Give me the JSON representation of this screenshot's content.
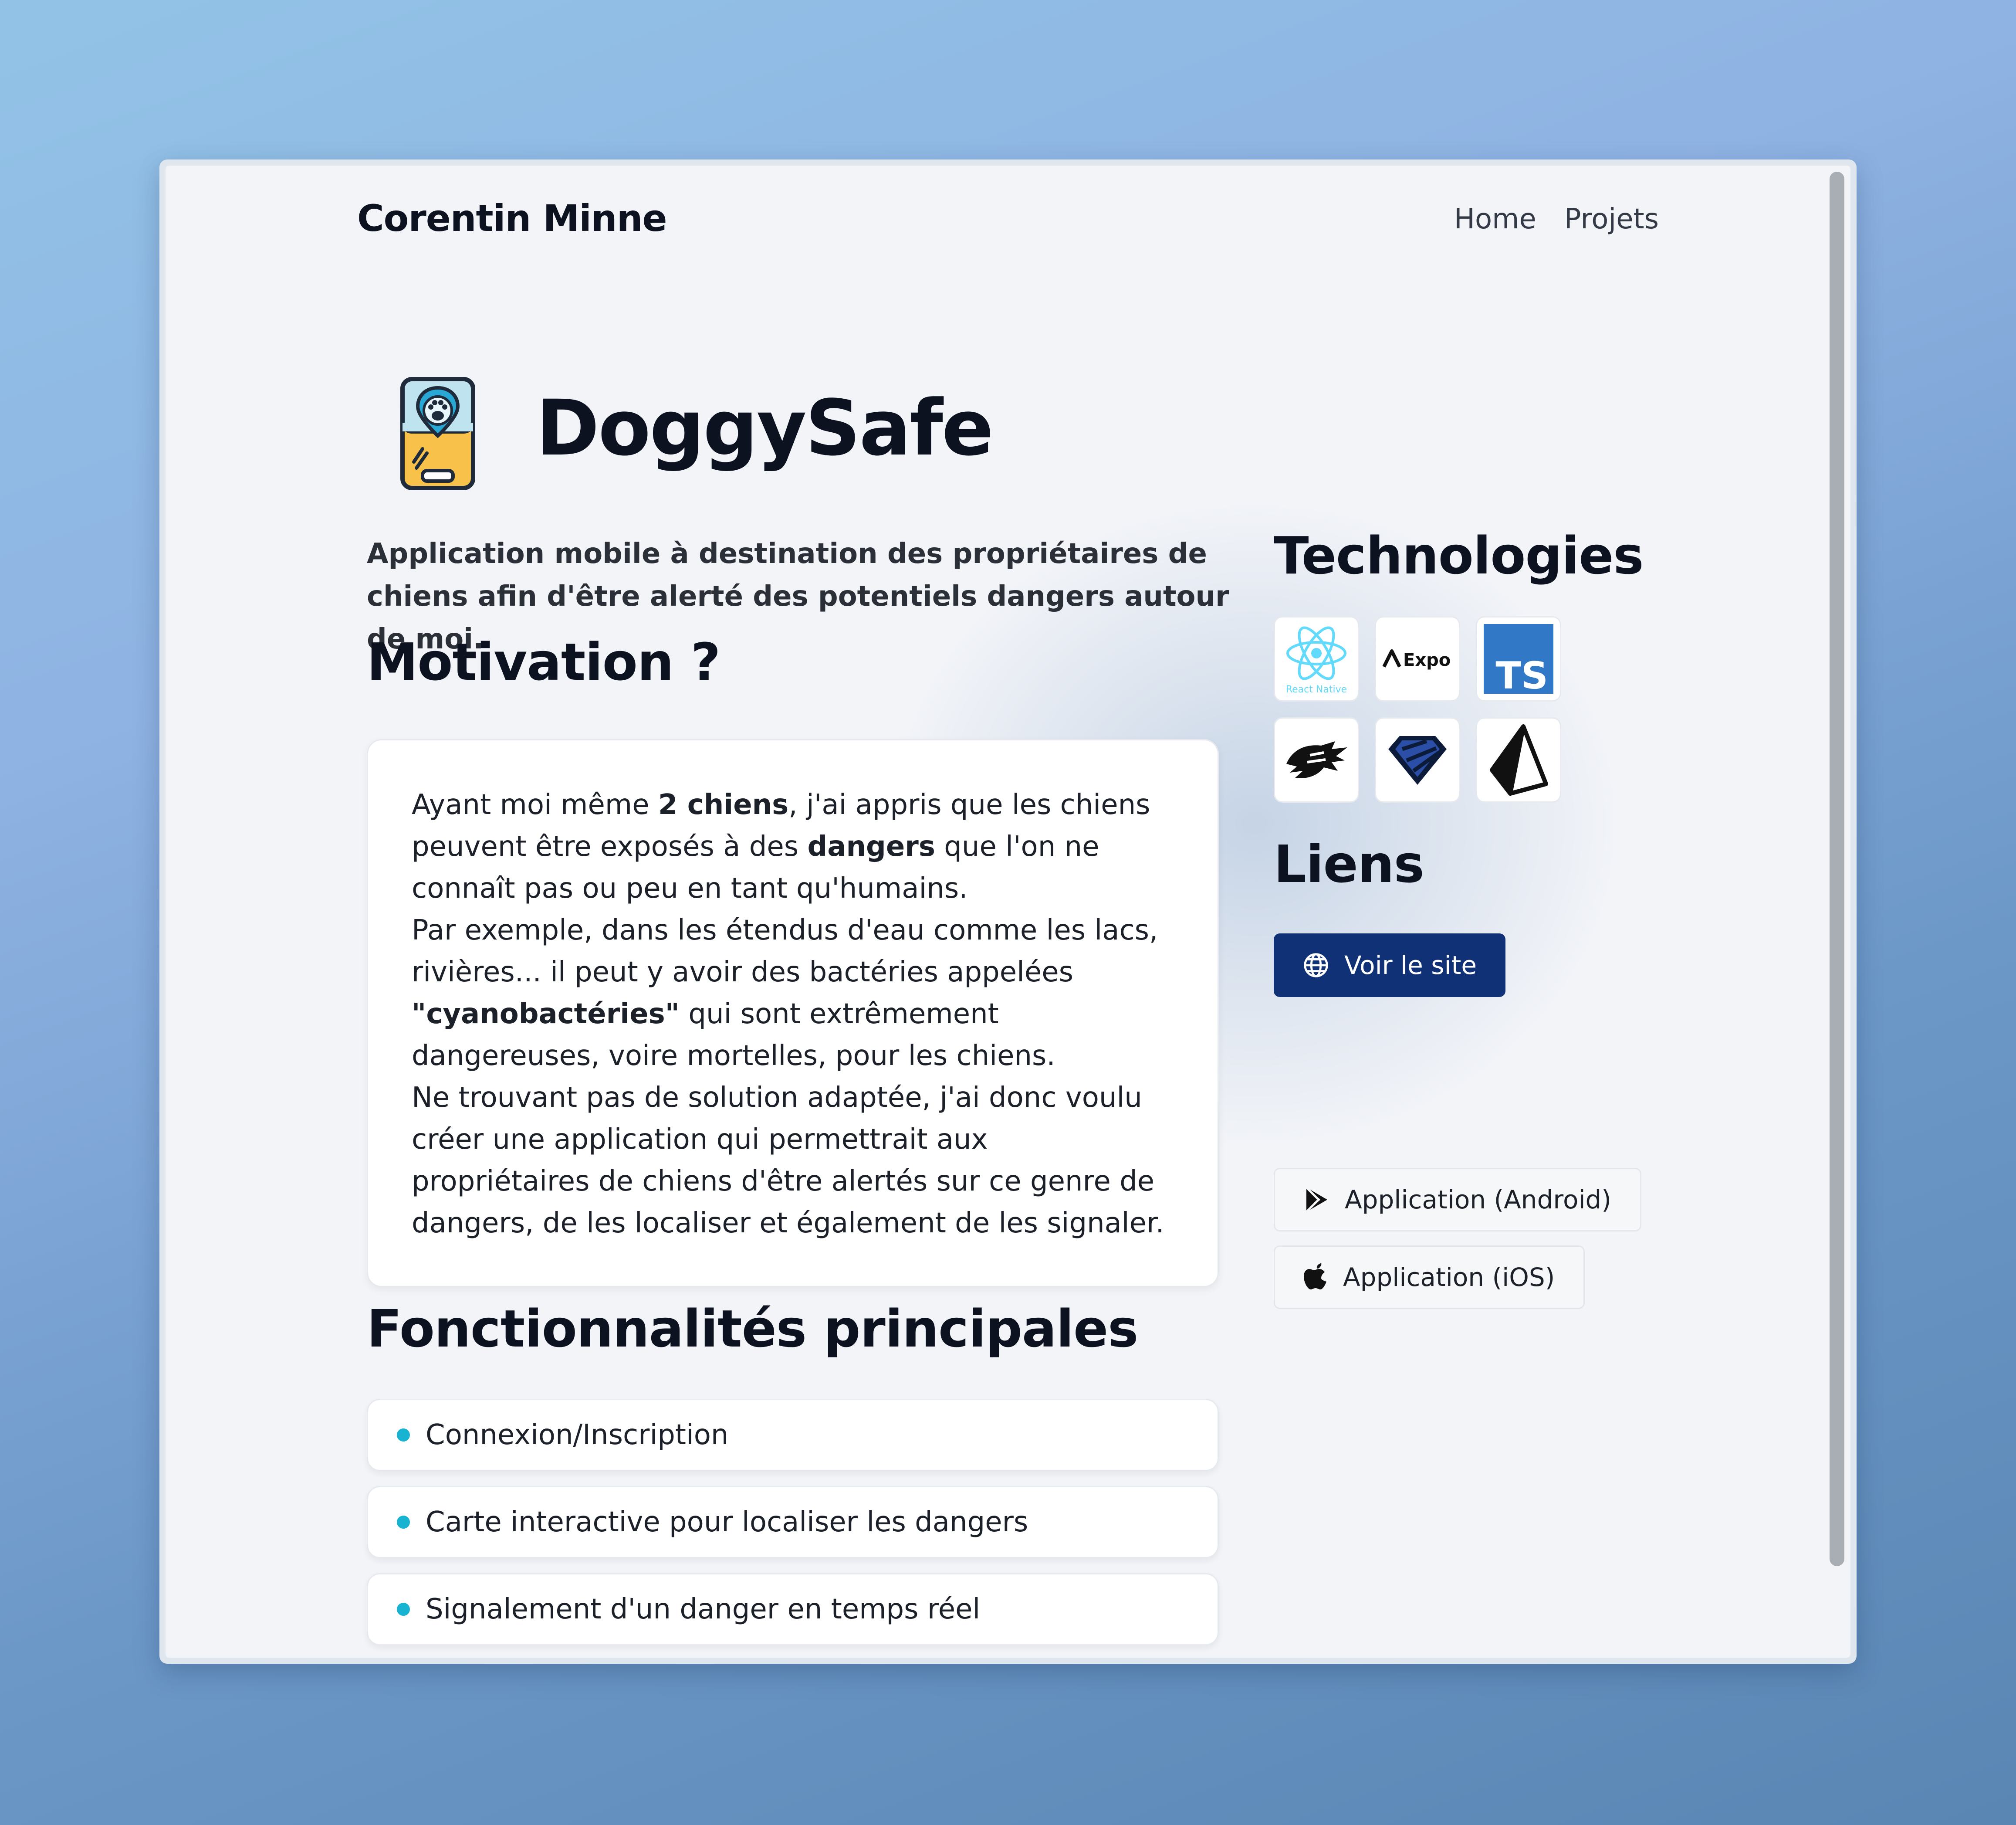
{
  "header": {
    "brand": "Corentin Minne",
    "nav": [
      "Home",
      "Projets"
    ]
  },
  "project": {
    "title": "DoggySafe",
    "icon": "phone-paw-location-icon",
    "intro": "Application mobile à destination des propriétaires de chiens afin d'être alerté des potentiels dangers autour de moi."
  },
  "motivation": {
    "heading": "Motivation ?",
    "p1_a": "Ayant moi même ",
    "p1_b": "2 chiens",
    "p1_c": ", j'ai appris que les chiens peuvent être exposés à des ",
    "p1_d": "dangers",
    "p1_e": " que l'on ne connaît pas ou peu en tant qu'humains.",
    "p2_a": "Par exemple, dans les étendus d'eau comme les lacs, rivières... il peut y avoir des bactéries appelées ",
    "p2_b": "\"cyanobactéries\"",
    "p2_c": " qui sont extrêmement dangereuses, voire mortelles, pour les chiens.",
    "p3": "Ne trouvant pas de solution adaptée, j'ai donc voulu créer une application qui permettrait aux propriétaires de chiens d'être alertés sur ce genre de dangers, de les localiser et également de les signaler."
  },
  "features": {
    "heading": "Fonctionnalités principales",
    "items": [
      "Connexion/Inscription",
      "Carte interactive pour localiser les dangers",
      "Signalement d'un danger en temps réel"
    ]
  },
  "technologies": {
    "heading": "Technologies",
    "items": [
      {
        "name": "react-native-icon",
        "label": "React Native"
      },
      {
        "name": "expo-icon",
        "label": "Expo"
      },
      {
        "name": "typescript-icon",
        "label": "TS"
      },
      {
        "name": "panther-icon"
      },
      {
        "name": "diamond-icon"
      },
      {
        "name": "prisma-icon"
      }
    ]
  },
  "links": {
    "heading": "Liens",
    "site": "Voir le site",
    "android": "Application (Android)",
    "ios": "Application (iOS)"
  },
  "colors": {
    "primary_button": "#113177",
    "feature_dot": "#17b3d1",
    "typescript_blue": "#3178c6"
  }
}
